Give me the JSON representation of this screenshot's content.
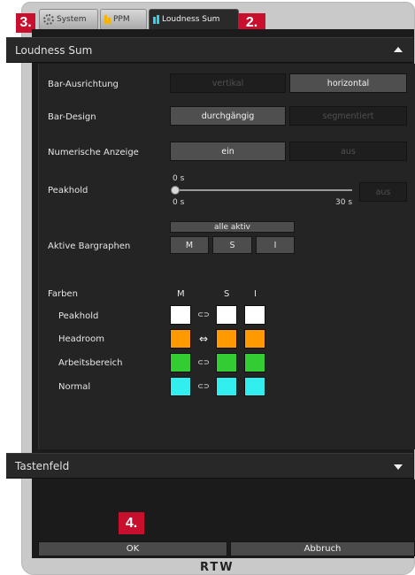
{
  "tabs": [
    {
      "label": "System",
      "icon": "gear-icon"
    },
    {
      "label": "PPM",
      "icon": "ppm-bars-icon"
    },
    {
      "label": "Loudness Sum",
      "icon": "loudness-bars-icon"
    }
  ],
  "callouts": {
    "tab_left": "3.",
    "tab_right": "2.",
    "ok": "4."
  },
  "section": {
    "title": "Loudness Sum"
  },
  "settings": {
    "bar_ausrichtung": {
      "label": "Bar-Ausrichtung",
      "options": [
        "vertikal",
        "horizontal"
      ],
      "selected": "horizontal"
    },
    "bar_design": {
      "label": "Bar-Design",
      "options": [
        "durchgängig",
        "segmentiert"
      ],
      "selected": "durchgängig"
    },
    "numerische_anzeige": {
      "label": "Numerische Anzeige",
      "options": [
        "ein",
        "aus"
      ],
      "selected": "ein"
    },
    "peakhold": {
      "label": "Peakhold",
      "value_top": "0 s",
      "min_label": "0 s",
      "max_label": "30 s",
      "off_label": "aus",
      "level": 0
    },
    "aktive_bargraphen": {
      "label": "Aktive Bargraphen",
      "all_label": "alle aktiv",
      "buttons": [
        "M",
        "S",
        "I"
      ]
    }
  },
  "farben": {
    "label": "Farben",
    "columns": [
      "M",
      "S",
      "I"
    ],
    "rows": [
      {
        "label": "Peakhold",
        "color": "#ffffff",
        "link": "broken"
      },
      {
        "label": "Headroom",
        "color": "#ff9900",
        "link": "linked"
      },
      {
        "label": "Arbeitsbereich",
        "color": "#33cc33",
        "link": "broken"
      },
      {
        "label": "Normal",
        "color": "#33eeee",
        "link": "broken"
      }
    ]
  },
  "tastenfeld": {
    "title": "Tastenfeld"
  },
  "footer": {
    "ok_label": "OK",
    "cancel_label": "Abbruch"
  },
  "brand": "RTW"
}
